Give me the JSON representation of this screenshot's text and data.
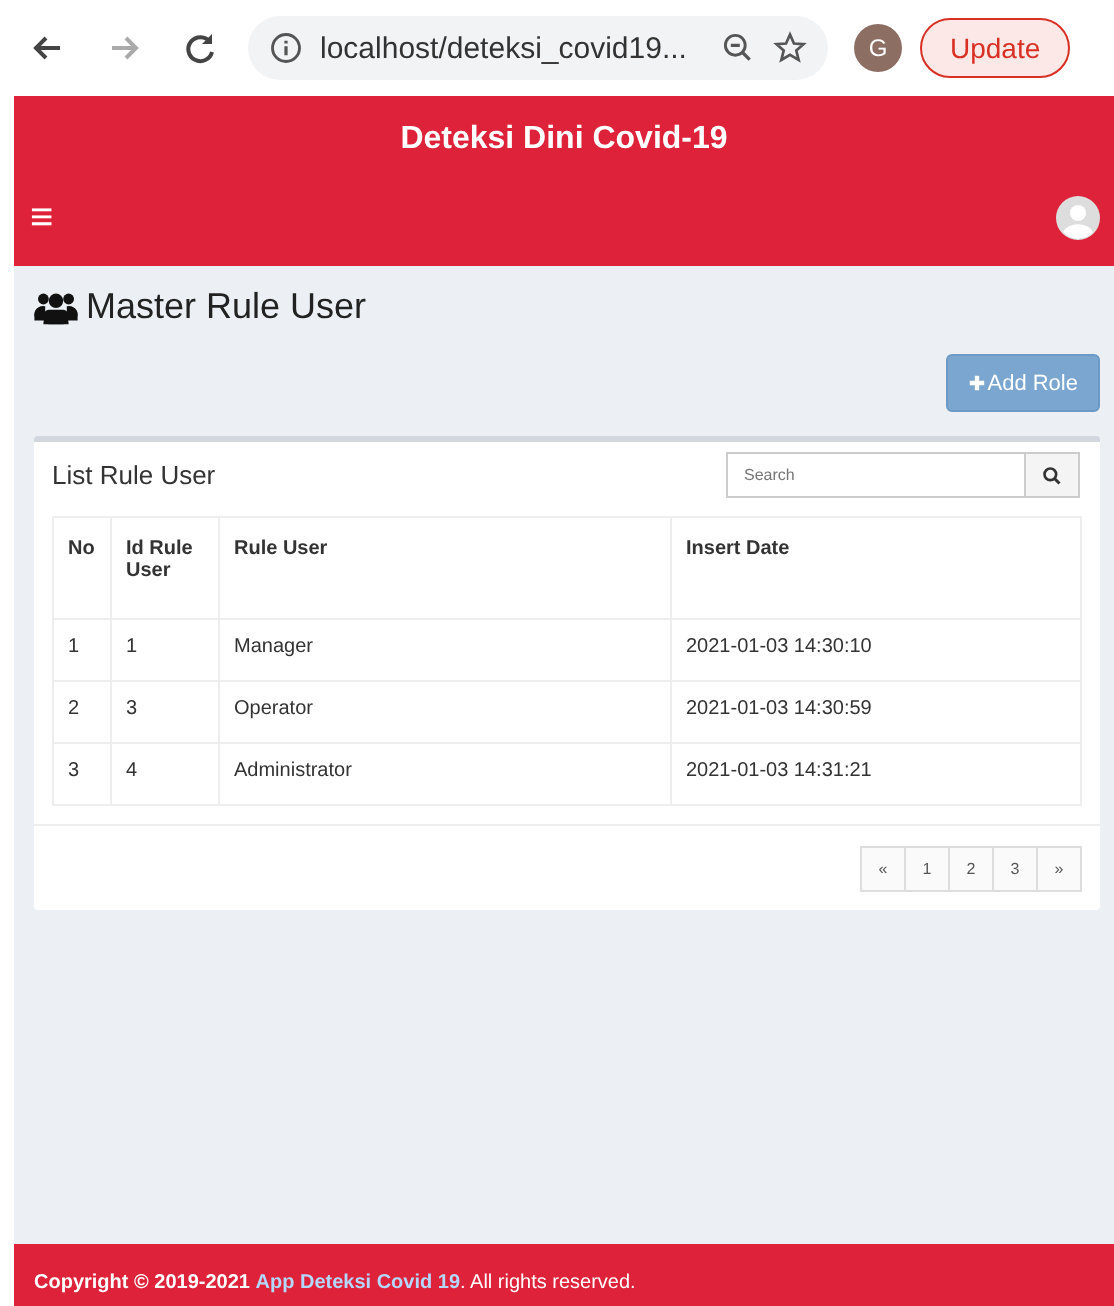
{
  "browser": {
    "url": "localhost/deteksi_covid19...",
    "profile": "G",
    "update_button": "Update"
  },
  "header": {
    "title": "Deteksi Dini Covid-19",
    "menu_icon": "≡"
  },
  "page": {
    "title": "Master Rule User",
    "add_button": "Add Role"
  },
  "card": {
    "title": "List Rule User",
    "search": {
      "placeholder": "Search"
    },
    "table": {
      "columns": [
        "No",
        "Id Rule User",
        "Rule User",
        "Insert Date"
      ],
      "rows": [
        [
          "1",
          "1",
          "Manager",
          "2021-01-03 14:30:10"
        ],
        [
          "2",
          "3",
          "Operator",
          "2021-01-03 14:30:59"
        ],
        [
          "3",
          "4",
          "Administrator",
          "2021-01-03 14:31:21"
        ]
      ]
    },
    "pagination": [
      "«",
      "1",
      "2",
      "3",
      "»"
    ]
  },
  "footer": {
    "prefix": "Copyright © 2019-2021",
    "link": "App Deteksi Covid 19",
    "suffix": ". All rights reserved."
  }
}
